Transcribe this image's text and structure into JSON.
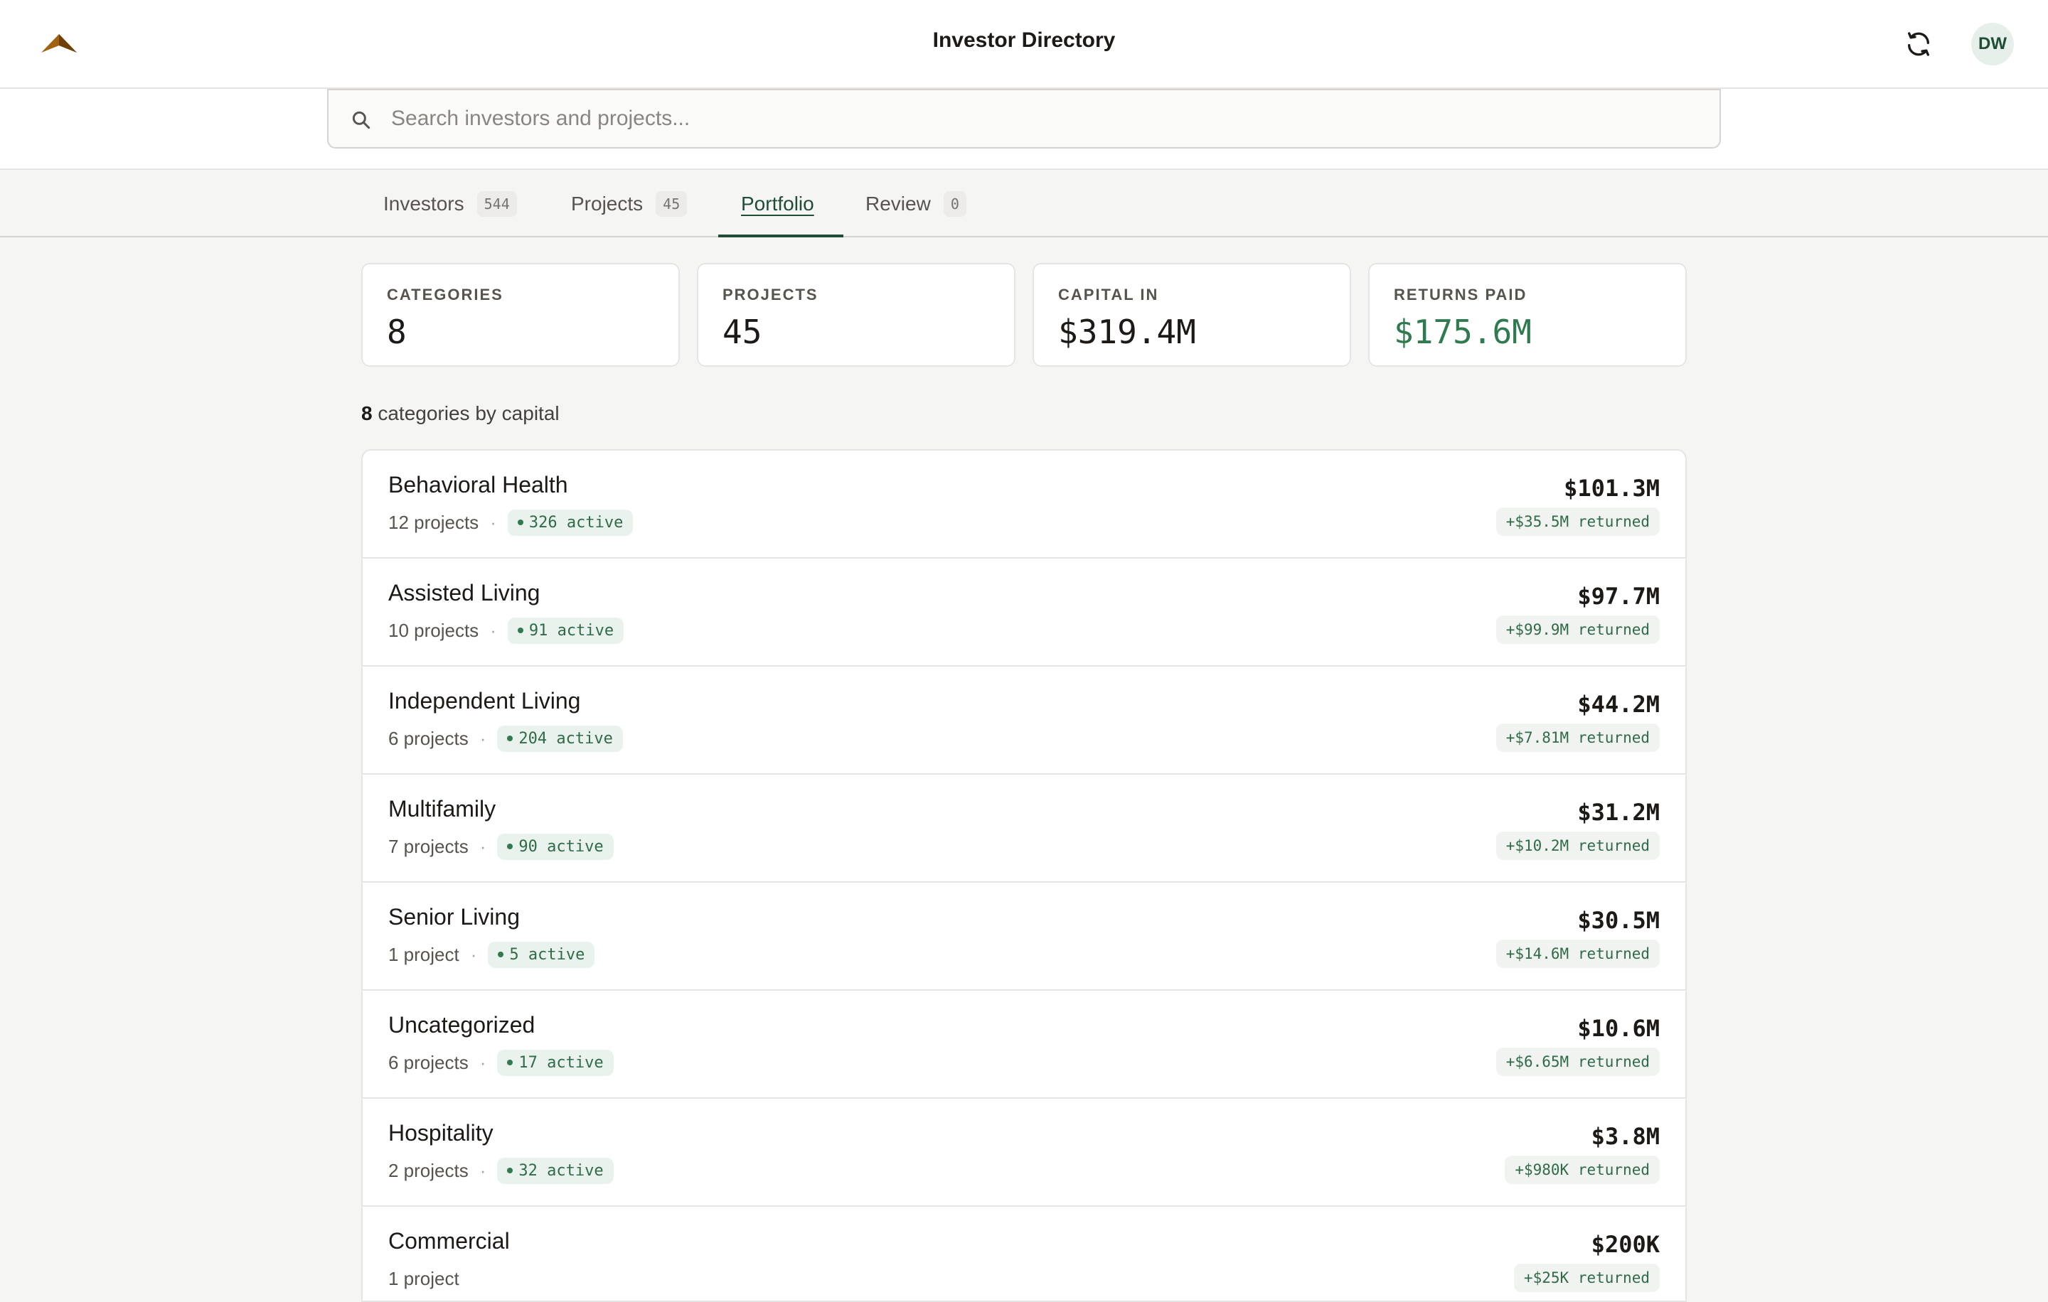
{
  "header": {
    "title": "Investor Directory",
    "avatar_initials": "DW",
    "logo_color": "#a0620e"
  },
  "search": {
    "placeholder": "Search investors and projects...",
    "value": ""
  },
  "tabs": [
    {
      "label": "Investors",
      "count": "544",
      "active": false
    },
    {
      "label": "Projects",
      "count": "45",
      "active": false
    },
    {
      "label": "Portfolio",
      "count": "",
      "active": true
    },
    {
      "label": "Review",
      "count": "0",
      "active": false
    }
  ],
  "stats": [
    {
      "label": "CATEGORIES",
      "value": "8"
    },
    {
      "label": "PROJECTS",
      "value": "45"
    },
    {
      "label": "CAPITAL IN",
      "value": "$319.4M"
    },
    {
      "label": "RETURNS PAID",
      "value": "$175.6M"
    }
  ],
  "summary": {
    "count": "8",
    "text": "categories by capital"
  },
  "categories": [
    {
      "name": "Behavioral Health",
      "projects": "12 projects",
      "active": "326 active",
      "amount": "$101.3M",
      "returned": "+$35.5M returned"
    },
    {
      "name": "Assisted Living",
      "projects": "10 projects",
      "active": "91 active",
      "amount": "$97.7M",
      "returned": "+$99.9M returned"
    },
    {
      "name": "Independent Living",
      "projects": "6 projects",
      "active": "204 active",
      "amount": "$44.2M",
      "returned": "+$7.81M returned"
    },
    {
      "name": "Multifamily",
      "projects": "7 projects",
      "active": "90 active",
      "amount": "$31.2M",
      "returned": "+$10.2M returned"
    },
    {
      "name": "Senior Living",
      "projects": "1 project",
      "active": "5 active",
      "amount": "$30.5M",
      "returned": "+$14.6M returned"
    },
    {
      "name": "Uncategorized",
      "projects": "6 projects",
      "active": "17 active",
      "amount": "$10.6M",
      "returned": "+$6.65M returned"
    },
    {
      "name": "Hospitality",
      "projects": "2 projects",
      "active": "32 active",
      "amount": "$3.8M",
      "returned": "+$980K returned"
    },
    {
      "name": "Commercial",
      "projects": "1 project",
      "active": "",
      "amount": "$200K",
      "returned": "+$25K returned"
    }
  ],
  "colors": {
    "accent_green": "#1f4d36",
    "returns_green": "#2f7a4f",
    "background": "#f5f5f4"
  }
}
